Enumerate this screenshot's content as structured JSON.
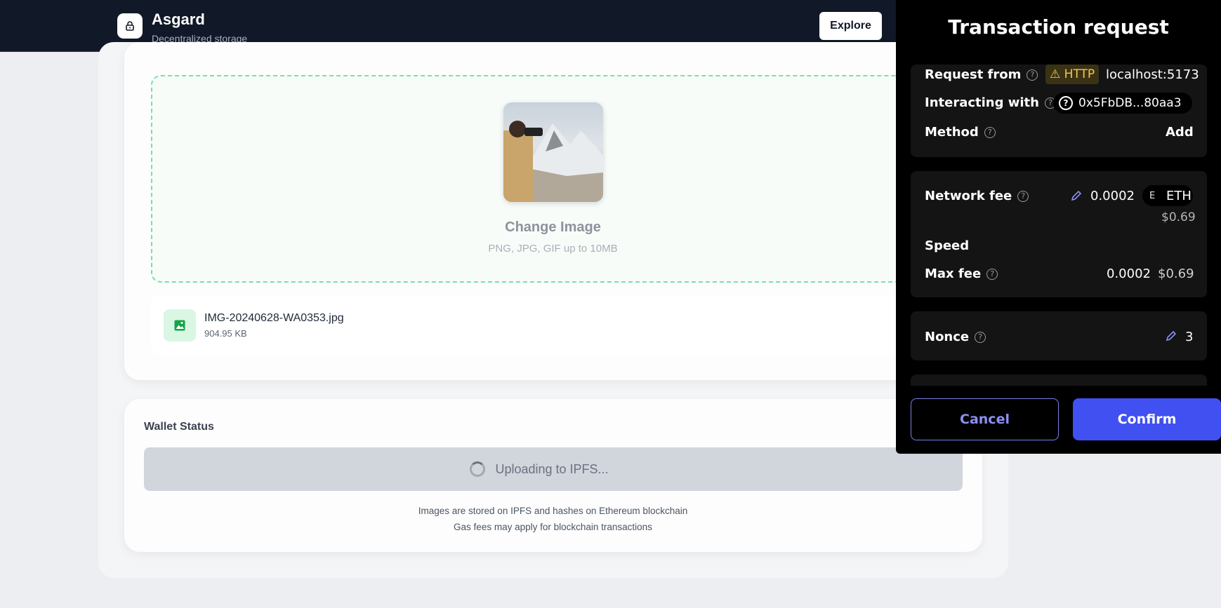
{
  "header": {
    "app_name": "Asgard",
    "tagline": "Decentralized storage",
    "explore_label": "Explore"
  },
  "upload": {
    "change_label": "Change Image",
    "hint": "PNG, JPG, GIF up to 10MB",
    "file_name": "IMG-20240628-WA0353.jpg",
    "file_size": "904.95 KB"
  },
  "wallet_status": {
    "title": "Wallet Status",
    "button_label": "Uploading to IPFS...",
    "note_1": "Images are stored on IPFS and hashes on Ethereum blockchain",
    "note_2": "Gas fees may apply for blockchain transactions"
  },
  "tx": {
    "title": "Transaction request",
    "request_from_label": "Request from",
    "http_badge": "HTTP",
    "origin": "localhost:5173",
    "interacting_label": "Interacting with",
    "contract_address": "0x5FbDB...80aa3",
    "method_label": "Method",
    "method_value": "Add",
    "network_fee_label": "Network fee",
    "network_fee_value": "0.0002",
    "network_fee_currency": "ETH",
    "network_fee_usd": "$0.69",
    "speed_label": "Speed",
    "max_fee_label": "Max fee",
    "max_fee_value": "0.0002",
    "max_fee_usd": "$0.69",
    "nonce_label": "Nonce",
    "nonce_value": "3",
    "cancel_label": "Cancel",
    "confirm_label": "Confirm"
  },
  "colors": {
    "header_bg": "#111827",
    "dropzone_border": "#6ee7a1",
    "confirm_bg": "#4150f0",
    "cancel_text": "#8b90f3",
    "http_warning": "#f3c84b"
  },
  "icons": {
    "brand": "lock-icon",
    "file": "image-icon",
    "warning": "warning-icon",
    "edit": "pencil-icon",
    "help": "help-circle-icon"
  }
}
